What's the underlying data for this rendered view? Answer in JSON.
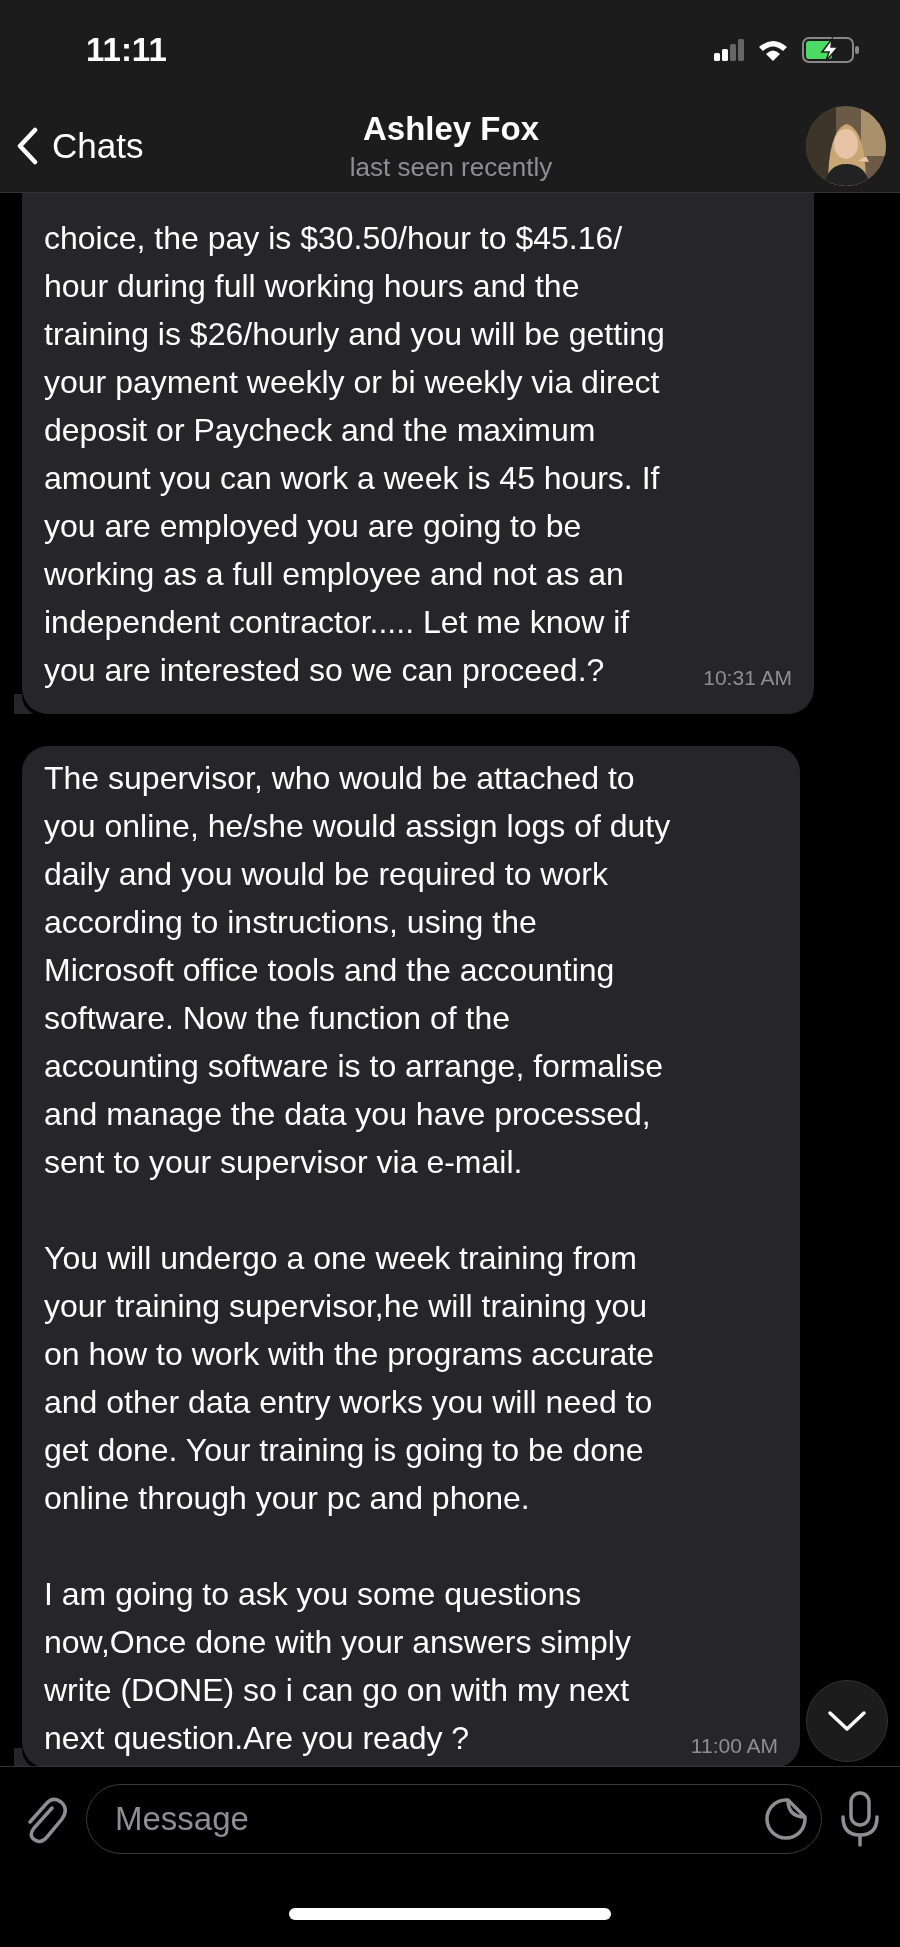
{
  "status_bar": {
    "time": "11:11"
  },
  "header": {
    "back_label": "Chats",
    "title": "Ashley Fox",
    "subtitle": "last seen recently"
  },
  "messages": [
    {
      "paragraphs": [
        "choice, the pay is $30.50/hour to $45.16/\nhour  during full working hours and the\ntraining is $26/hourly and you will be getting\nyour payment weekly or bi weekly via direct\ndeposit or Paycheck and the maximum\namount you can work a week is 45 hours. If\nyou are employed you are going to be\nworking as a full employee and not as an\nindependent contractor..... Let me know if\nyou are interested so we can proceed.?"
      ],
      "time": "10:31 AM"
    },
    {
      "paragraphs": [
        "The supervisor, who would be attached to\nyou online, he/she would assign logs of duty\ndaily and you would be required to work\naccording to instructions, using the\nMicrosoft office tools and the accounting\nsoftware. Now the function of the\naccounting software is to arrange, formalise\nand manage the data you have processed,\nsent to your supervisor via e-mail.",
        "You will undergo a one week training from\nyour training supervisor,he will training you\non how to work with the programs accurate\nand other data entry works you will need to\nget done. Your training is going to be done\nonline through your pc and phone.",
        "I am going to ask you some questions\nnow,Once done with your answers simply\nwrite (DONE) so i can go on with my next\nnext question.Are you ready ?"
      ],
      "time": "11:00 AM"
    }
  ],
  "composer": {
    "placeholder": "Message"
  }
}
